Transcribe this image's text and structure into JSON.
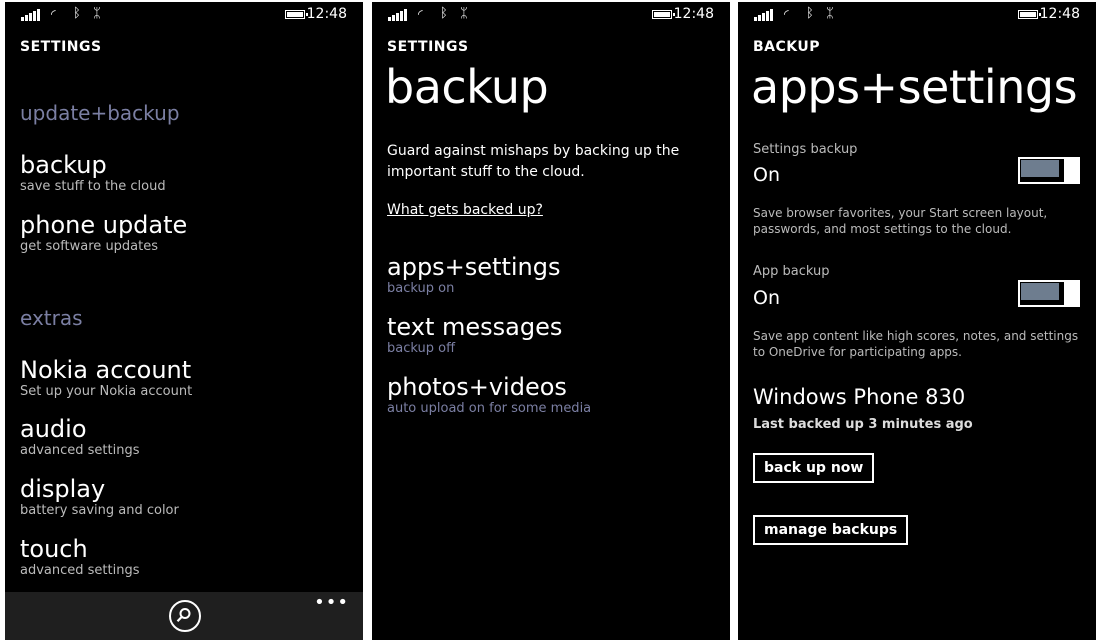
{
  "status": {
    "time": "12:48"
  },
  "screen1": {
    "title": "SETTINGS",
    "sections": [
      {
        "header": "update+backup",
        "items": [
          {
            "title": "backup",
            "subtitle": "save stuff to the cloud"
          },
          {
            "title": "phone update",
            "subtitle": "get software updates"
          }
        ]
      },
      {
        "header": "extras",
        "items": [
          {
            "title": "Nokia account",
            "subtitle": "Set up your Nokia account"
          },
          {
            "title": "audio",
            "subtitle": "advanced settings"
          },
          {
            "title": "display",
            "subtitle": "battery saving and color"
          },
          {
            "title": "touch",
            "subtitle": "advanced settings"
          }
        ]
      }
    ],
    "appbar": {
      "search_icon": "search-icon",
      "more": "•••"
    }
  },
  "screen2": {
    "small_title": "SETTINGS",
    "big_title": "backup",
    "intro": "Guard against mishaps by backing up the important stuff to the cloud.",
    "link": "What gets backed up?",
    "items": [
      {
        "title": "apps+settings",
        "subtitle": "backup on"
      },
      {
        "title": "text messages",
        "subtitle": "backup off"
      },
      {
        "title": "photos+videos",
        "subtitle": "auto upload on for some media"
      }
    ]
  },
  "screen3": {
    "small_title": "BACKUP",
    "big_title": "apps+settings",
    "settings_backup": {
      "label": "Settings backup",
      "value": "On",
      "description": "Save browser favorites, your Start screen layout, passwords, and most settings to the cloud."
    },
    "app_backup": {
      "label": "App backup",
      "value": "On",
      "description": "Save app content like high scores, notes, and settings to OneDrive for participating apps."
    },
    "device": "Windows Phone 830",
    "last_backed": "Last backed up 3 minutes ago",
    "back_up_now": "back up now",
    "manage_backups": "manage backups"
  },
  "colors": {
    "accent": "#7b7fa3",
    "background": "#000000",
    "toggle_fill": "#6e7d8f",
    "appbar": "#1f1f1f"
  }
}
